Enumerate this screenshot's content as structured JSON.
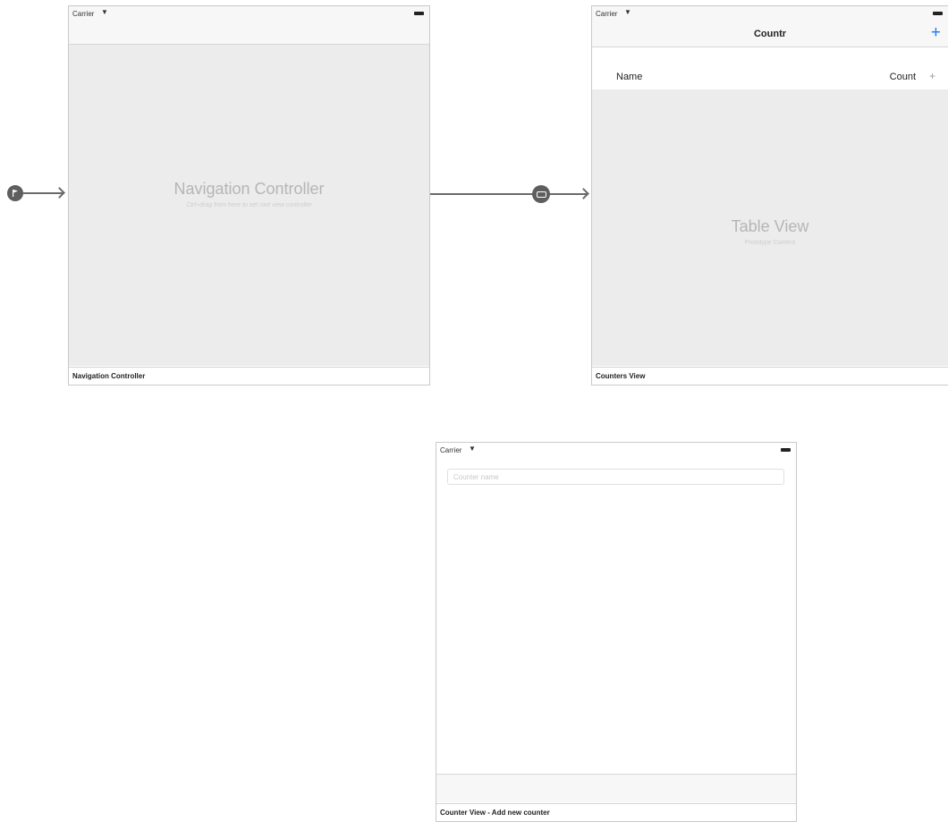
{
  "status_bar": {
    "carrier": "Carrier"
  },
  "navigation_scene": {
    "title": "Navigation Controller",
    "hint": "Ctrl+drag from here to set root view controller",
    "footer": "Navigation Controller"
  },
  "counters_scene": {
    "nav_title": "Countr",
    "add_button": "+",
    "cell": {
      "name": "Name",
      "count": "Count",
      "stepper": "+"
    },
    "table_title": "Table View",
    "table_subtitle": "Prototype Content",
    "footer": "Counters View"
  },
  "counter_scene": {
    "text_field_placeholder": "Counter name",
    "footer": "Counter View - Add new counter"
  },
  "colors": {
    "tint": "#1a7cf5",
    "canvas_gray": "#ececec",
    "connector": "#6a6a6a"
  }
}
